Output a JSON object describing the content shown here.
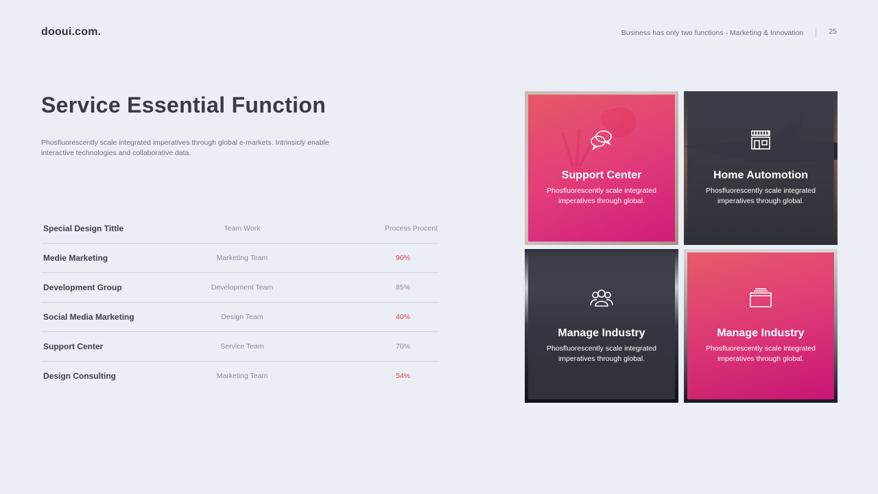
{
  "header": {
    "logo": "dooui.com.",
    "tagline": "Business has only two functions - Marketing & Innovation",
    "page_number": "25"
  },
  "main": {
    "title": "Service Essential Function",
    "description": "Phosfluorescently scale integrated imperatives through global e-markets. Intrinsicly enable interactive technologies and collaborative data."
  },
  "table": {
    "headers": [
      "Special Design Tittle",
      "Team Work",
      "Process Procent"
    ],
    "rows": [
      {
        "name": "Medie Marketing",
        "team": "Marketing Team",
        "percent": "90%",
        "highlight": true
      },
      {
        "name": "Development Group",
        "team": "Development Team",
        "percent": "85%",
        "highlight": false
      },
      {
        "name": "Social Media Marketing",
        "team": "Design Team",
        "percent": "40%",
        "highlight": true
      },
      {
        "name": "Support Center",
        "team": "Service Team",
        "percent": "70%",
        "highlight": false
      },
      {
        "name": "Design Consulting",
        "team": "Marketing Team",
        "percent": "54%",
        "highlight": true
      }
    ]
  },
  "tiles": [
    {
      "title": "Support Center",
      "text": "Phosfluorescently scale integrated imperatives through global.",
      "icon": "chat-bubbles-icon",
      "style": "pink"
    },
    {
      "title": "Home Automotion",
      "text": "Phosfluorescently scale integrated imperatives through global.",
      "icon": "storefront-icon",
      "style": "dark"
    },
    {
      "title": "Manage Industry",
      "text": "Phosfluorescently scale integrated imperatives through global.",
      "icon": "users-group-icon",
      "style": "dark"
    },
    {
      "title": "Manage Industry",
      "text": "Phosfluorescently scale integrated imperatives through global.",
      "icon": "stacked-layers-icon",
      "style": "pink"
    }
  ],
  "colors": {
    "background": "#eceef6",
    "accent_red": "#e0424f",
    "pink_start": "#e85260",
    "pink_end": "#d0167a",
    "dark_panel": "#3a3c46"
  }
}
